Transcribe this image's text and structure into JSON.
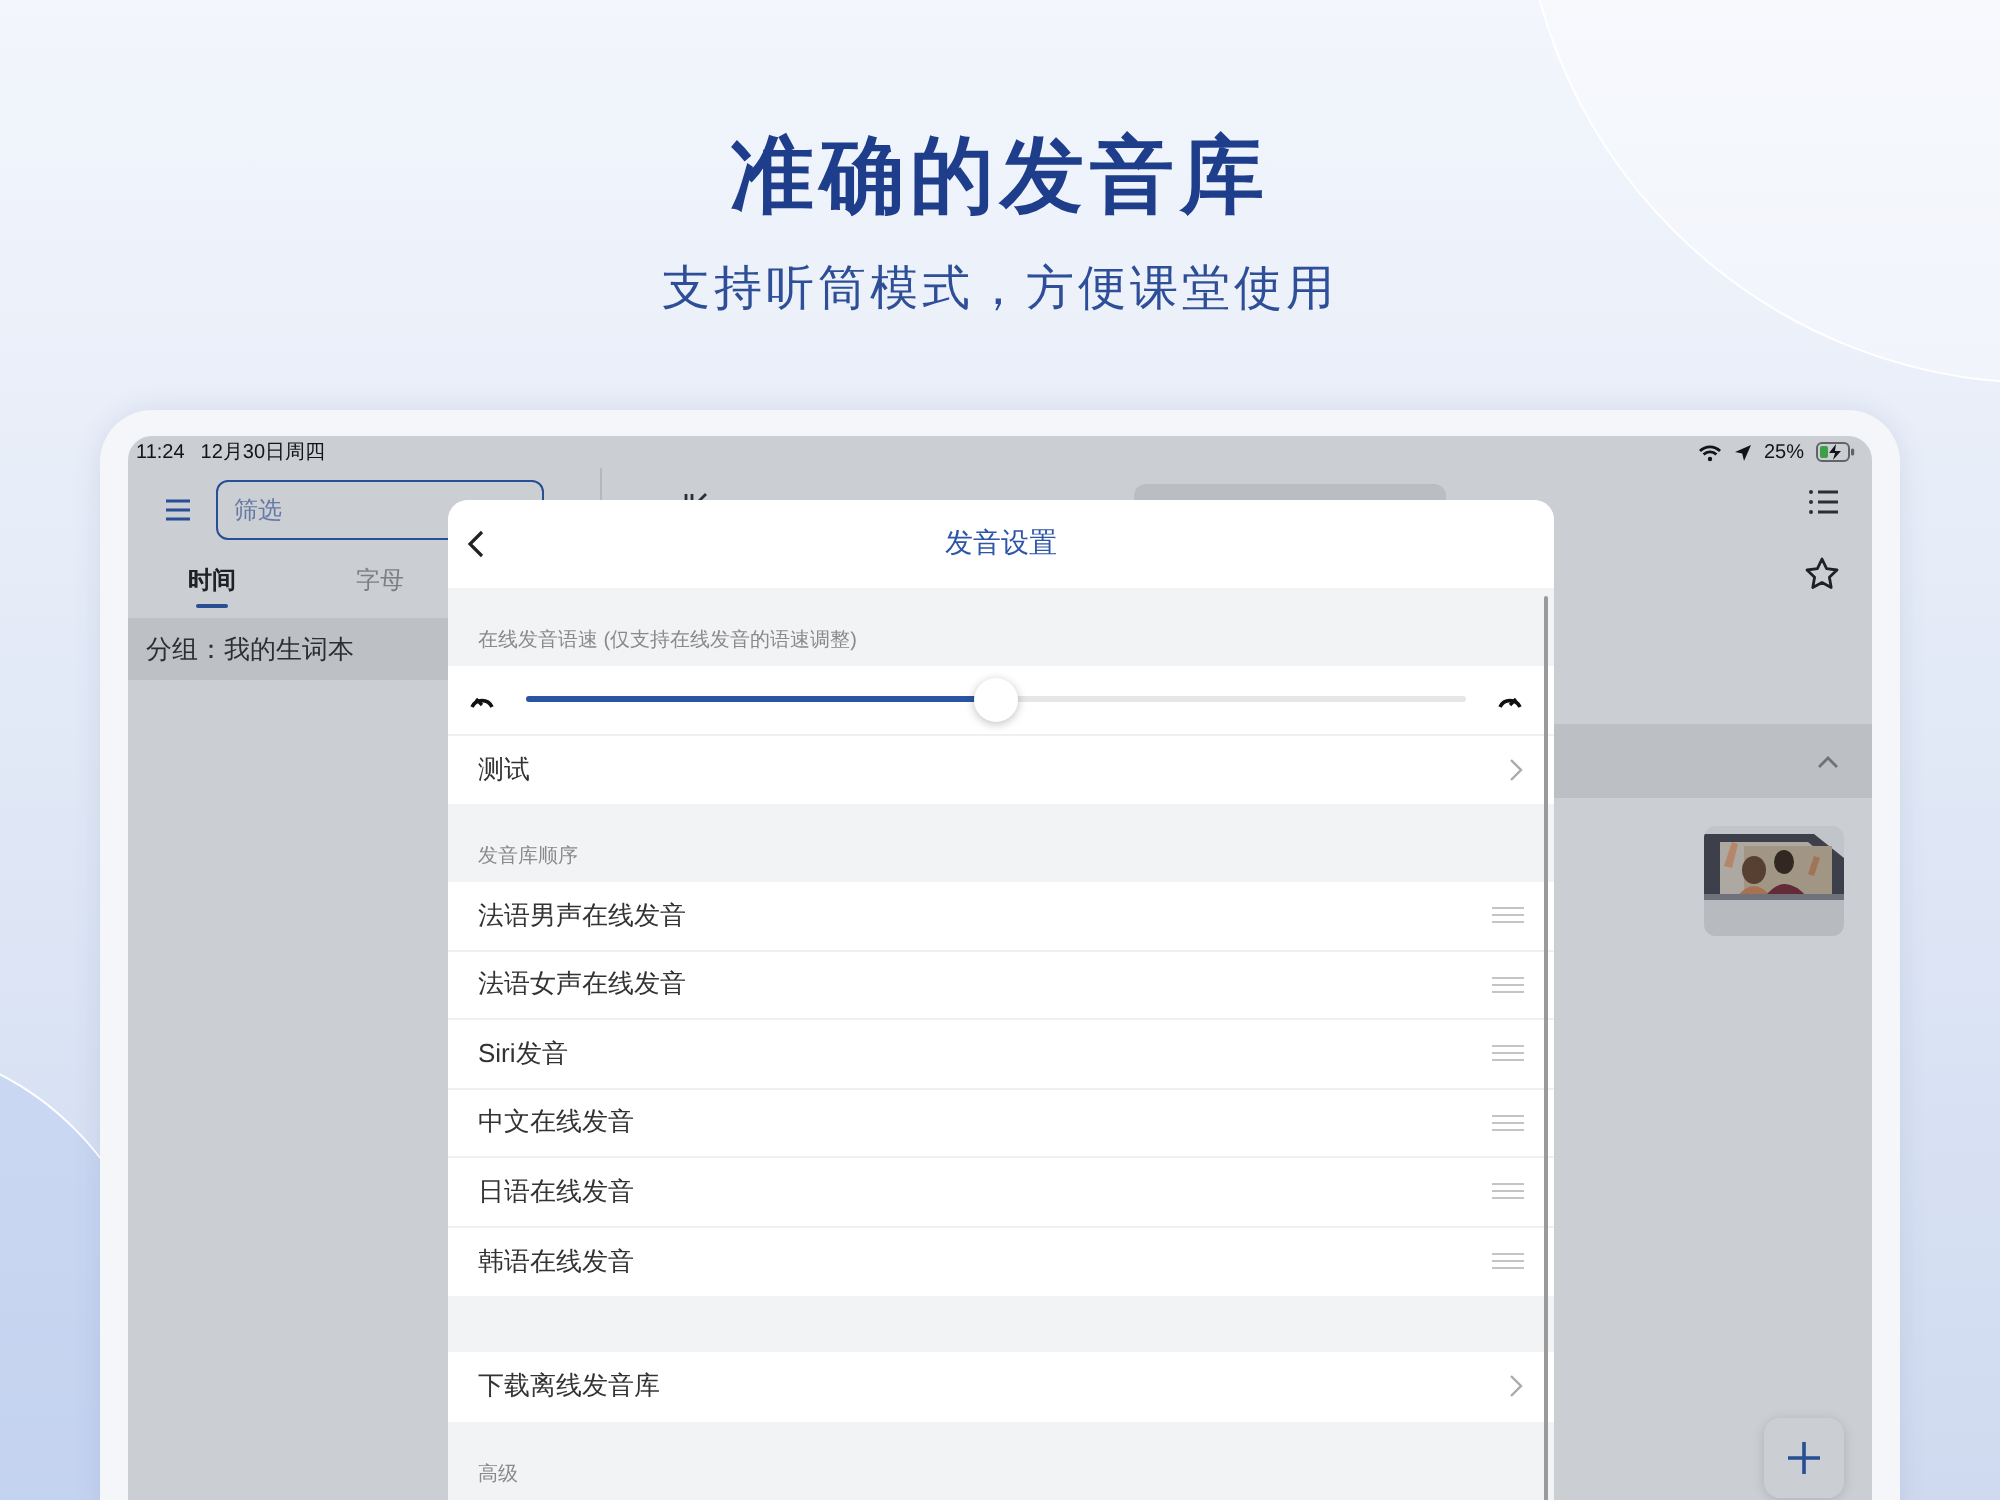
{
  "headline": "准确的发音库",
  "subheadline": "支持听筒模式，方便课堂使用",
  "status_bar": {
    "time": "11:24",
    "date": "12月30日周四",
    "battery": "25%"
  },
  "sidebar": {
    "search": {
      "placeholder": "筛选"
    },
    "tabs": [
      {
        "label": "时间",
        "selected": true
      },
      {
        "label": "字母",
        "selected": false
      }
    ],
    "group": "分组：我的生词本"
  },
  "modal": {
    "title": "发音设置",
    "sections": [
      {
        "header": "在线发音语速 (仅支持在线发音的语速调整)",
        "rows": [
          {
            "kind": "slider",
            "level": 0.5
          },
          {
            "kind": "link",
            "label": "测试"
          }
        ]
      },
      {
        "header": "发音库顺序",
        "rows": [
          {
            "kind": "reorder",
            "label": "法语男声在线发音"
          },
          {
            "kind": "reorder",
            "label": "法语女声在线发音"
          },
          {
            "kind": "reorder",
            "label": "Siri发音"
          },
          {
            "kind": "reorder",
            "label": "中文在线发音"
          },
          {
            "kind": "reorder",
            "label": "日语在线发音"
          },
          {
            "kind": "reorder",
            "label": "韩语在线发音"
          }
        ]
      },
      {
        "rows": [
          {
            "kind": "link",
            "label": "下载离线发音库"
          }
        ]
      },
      {
        "header": "高级"
      }
    ]
  }
}
